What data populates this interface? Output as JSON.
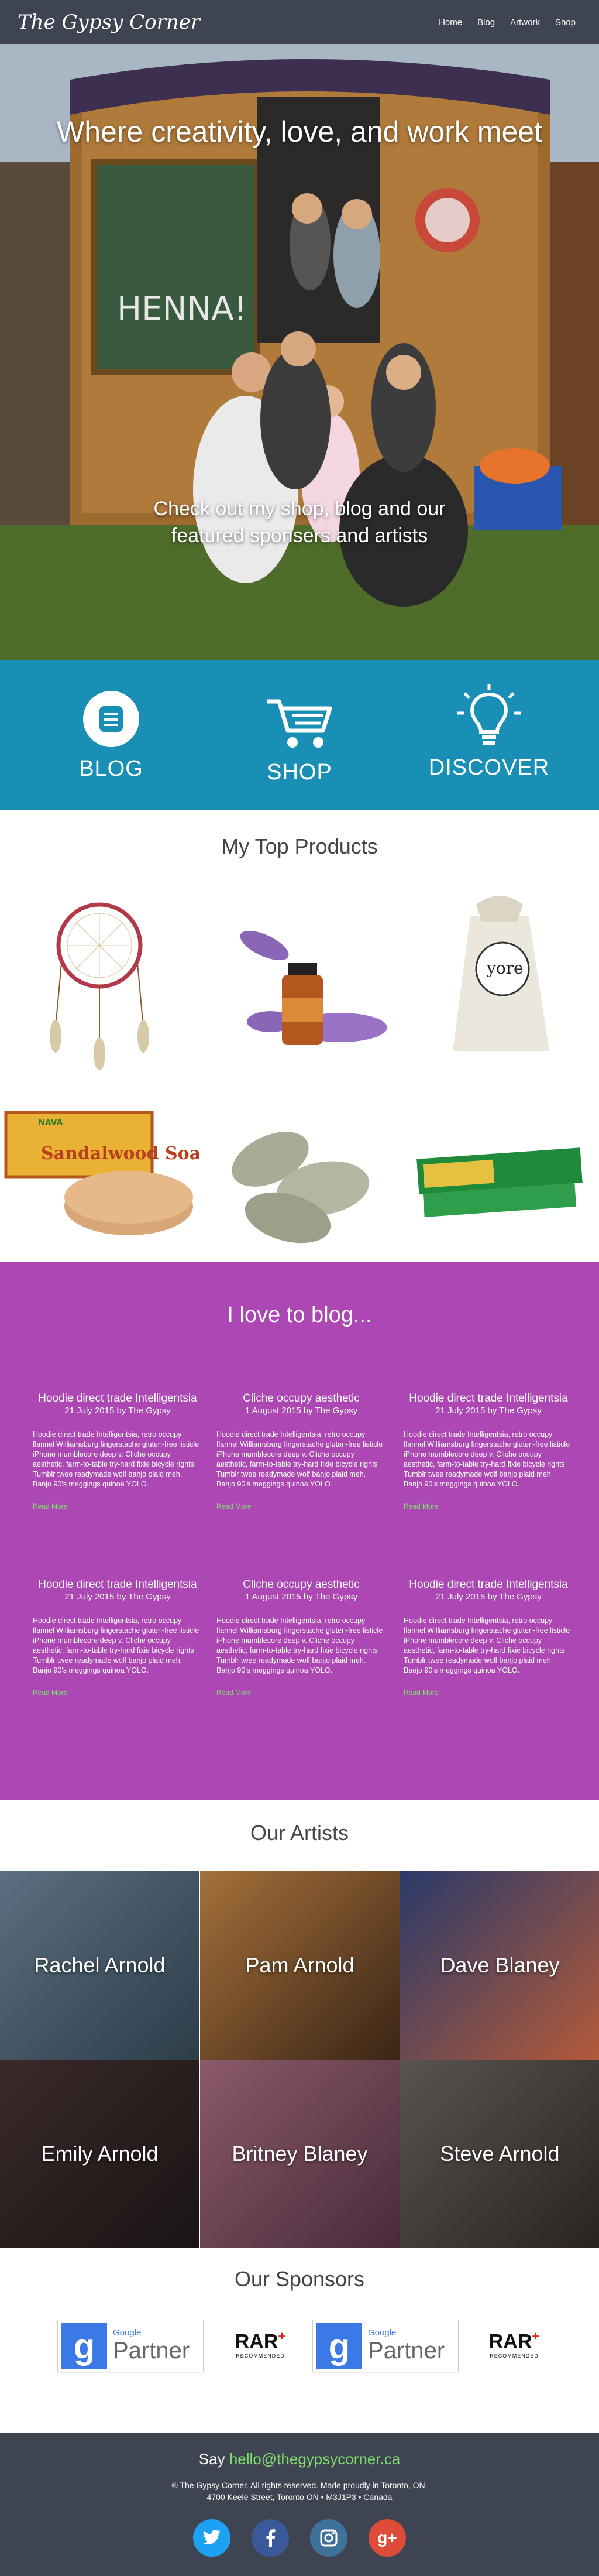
{
  "header": {
    "brand": "The Gypsy Corner",
    "nav": [
      "Home",
      "Blog",
      "Artwork",
      "Shop"
    ]
  },
  "hero": {
    "title": "Where creativity, love, and work meet",
    "subtitle": "Check out my shop, blog and our featured sponsers and artists",
    "sign_text": "HENNA!"
  },
  "features": [
    {
      "label": "BLOG",
      "icon": "document-icon"
    },
    {
      "label": "SHOP",
      "icon": "cart-icon"
    },
    {
      "label": "DISCOVER",
      "icon": "lightbulb-icon"
    }
  ],
  "products": {
    "title": "My Top Products",
    "items": [
      {
        "name": "dreamcatcher"
      },
      {
        "name": "lavender-oil"
      },
      {
        "name": "yore-soap-bag",
        "label": "yore"
      },
      {
        "name": "sandalwood-soap",
        "label": "Sandalwood Soap",
        "brand": "NAVA"
      },
      {
        "name": "sage-bundles"
      },
      {
        "name": "incense-pack"
      }
    ]
  },
  "blog": {
    "title": "I love to blog...",
    "read_more": "Read More",
    "body": "Hoodie direct trade Intelligentsia, retro occupy flannel Williamsburg fingerstache gluten-free listicle iPhone mumblecore deep v. Cliche occupy aesthetic, farm-to-table try-hard fixie bicycle rights Tumblr twee readymade wolf banjo plaid meh. Banjo 90's meggings quinoa YOLO.",
    "posts": [
      {
        "title": "Hoodie direct trade Intelligentsia",
        "meta": "21 July 2015 by The Gypsy"
      },
      {
        "title": "Cliche occupy aesthetic",
        "meta": "1 August 2015 by The Gypsy"
      },
      {
        "title": "Hoodie direct trade Intelligentsia",
        "meta": "21 July 2015 by The Gypsy"
      },
      {
        "title": "Hoodie direct trade Intelligentsia",
        "meta": "21 July 2015 by The Gypsy"
      },
      {
        "title": "Cliche occupy aesthetic",
        "meta": "1 August 2015 by The Gypsy"
      },
      {
        "title": "Hoodie direct trade Intelligentsia",
        "meta": "21 July 2015 by The Gypsy"
      }
    ]
  },
  "artists": {
    "title": "Our Artists",
    "items": [
      "Rachel Arnold",
      "Pam Arnold",
      "Dave Blaney",
      "Emily Arnold",
      "Britney Blaney",
      "Steve Arnold"
    ]
  },
  "sponsors": {
    "title": "Our Sponsors",
    "google": {
      "small": "Google",
      "big": "Partner"
    },
    "rar": {
      "name": "RAR",
      "plus": "+",
      "sub": "RECOMMENDED"
    }
  },
  "footer": {
    "say": "Say",
    "email": "hello@thegypsycorner.ca",
    "copyright": "© The Gypsy Corner. All rights reserved. Made proudly in Toronto, ON.",
    "address": "4700 Keele Street, Toronto ON • M3J1P3 • Canada",
    "socials": [
      {
        "name": "twitter",
        "color": "#1da1f2"
      },
      {
        "name": "facebook",
        "color": "#3b5998"
      },
      {
        "name": "instagram",
        "color": "#3f729b"
      },
      {
        "name": "google-plus",
        "color": "#dd4b39"
      }
    ]
  }
}
